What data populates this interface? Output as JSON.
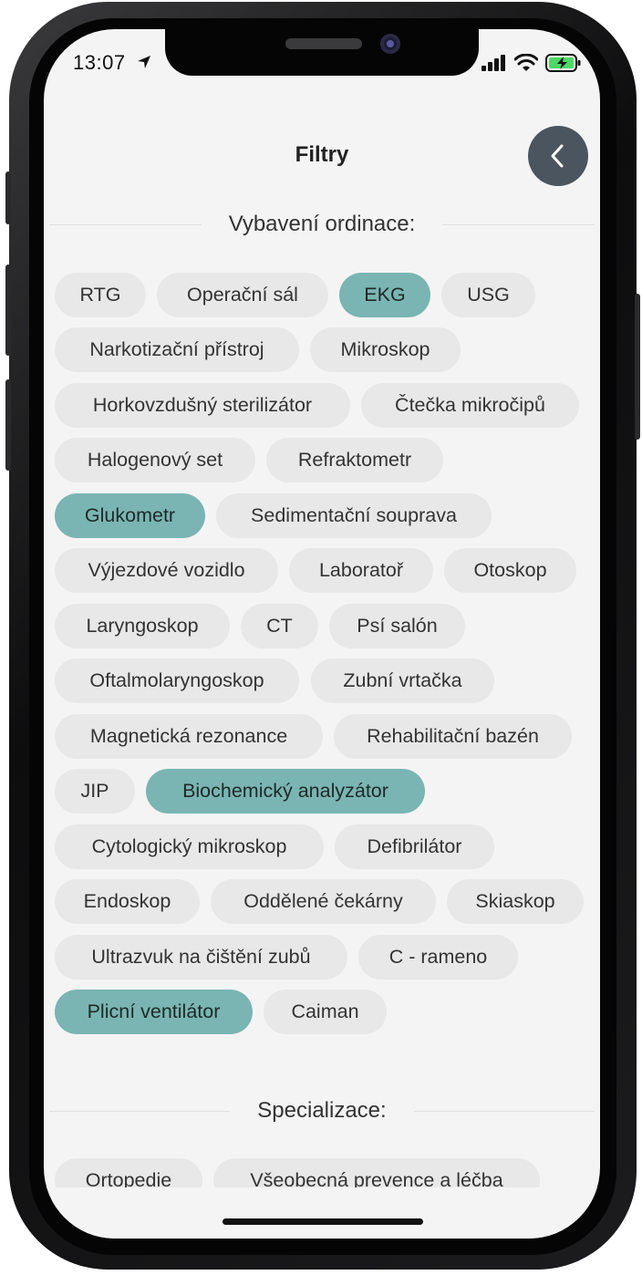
{
  "status_bar": {
    "time": "13:07"
  },
  "header": {
    "title": "Filtry"
  },
  "sections": {
    "equipment": {
      "title": "Vybavení ordinace:",
      "items": [
        {
          "label": "RTG",
          "selected": false
        },
        {
          "label": "Operační sál",
          "selected": false
        },
        {
          "label": "EKG",
          "selected": true
        },
        {
          "label": "USG",
          "selected": false
        },
        {
          "label": "Narkotizační přístroj",
          "selected": false
        },
        {
          "label": "Mikroskop",
          "selected": false
        },
        {
          "label": "Horkovzdušný sterilizátor",
          "selected": false
        },
        {
          "label": "Čtečka mikročipů",
          "selected": false
        },
        {
          "label": "Halogenový set",
          "selected": false
        },
        {
          "label": "Refraktometr",
          "selected": false
        },
        {
          "label": "Glukometr",
          "selected": true
        },
        {
          "label": "Sedimentační souprava",
          "selected": false
        },
        {
          "label": "Výjezdové vozidlo",
          "selected": false
        },
        {
          "label": "Laboratoř",
          "selected": false
        },
        {
          "label": "Otoskop",
          "selected": false
        },
        {
          "label": "Laryngoskop",
          "selected": false
        },
        {
          "label": "CT",
          "selected": false
        },
        {
          "label": "Psí salón",
          "selected": false
        },
        {
          "label": "Oftalmolaryngoskop",
          "selected": false
        },
        {
          "label": "Zubní vrtačka",
          "selected": false
        },
        {
          "label": "Magnetická rezonance",
          "selected": false
        },
        {
          "label": "Rehabilitační bazén",
          "selected": false
        },
        {
          "label": "JIP",
          "selected": false
        },
        {
          "label": "Biochemický analyzátor",
          "selected": true
        },
        {
          "label": "Cytologický mikroskop",
          "selected": false
        },
        {
          "label": "Defibrilátor",
          "selected": false
        },
        {
          "label": "Endoskop",
          "selected": false
        },
        {
          "label": "Oddělené čekárny",
          "selected": false
        },
        {
          "label": "Skiaskop",
          "selected": false
        },
        {
          "label": "Ultrazvuk na čištění zubů",
          "selected": false
        },
        {
          "label": "C - rameno",
          "selected": false
        },
        {
          "label": "Plicní ventilátor",
          "selected": true
        },
        {
          "label": "Caiman",
          "selected": false
        }
      ]
    },
    "specialization": {
      "title": "Specializace:",
      "items": [
        {
          "label": "Ortopedie",
          "selected": false
        },
        {
          "label": "Všeobecná prevence a léčba",
          "selected": false
        }
      ]
    }
  },
  "colors": {
    "selected_chip": "#7ab5b3",
    "chip": "#e8e8e8",
    "back_button": "#4a5560",
    "battery": "#4cd964"
  },
  "icons": [
    "location-arrow-icon",
    "signal-icon",
    "wifi-icon",
    "battery-icon",
    "chevron-left-icon"
  ]
}
